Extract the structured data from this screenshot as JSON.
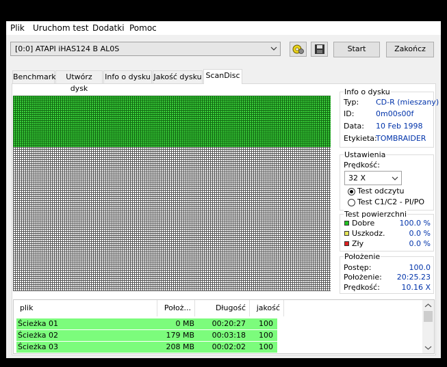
{
  "menu": [
    "Plik",
    "Uruchom test",
    "Dodatki",
    "Pomoc"
  ],
  "drive": {
    "selected": "[0:0]   ATAPI iHAS124   B AL0S"
  },
  "toolbar": {
    "start_label": "Start",
    "exit_label": "Zakończ"
  },
  "tabs": [
    "Benchmark",
    "Utwórz dysk",
    "Info o dysku",
    "Jakość dysku",
    "ScanDisc"
  ],
  "active_tab": "ScanDisc",
  "scan": {
    "done_fraction": 0.26
  },
  "disc_info": {
    "title": "Info o dysku",
    "type_label": "Typ:",
    "type_value": "CD-R (mieszany)",
    "id_label": "ID:",
    "id_value": "0m00s00f",
    "date_label": "Data:",
    "date_value": "10 Feb 1998",
    "label_label": "Etykieta:",
    "label_value": "TOMBRAIDER"
  },
  "settings": {
    "title": "Ustawienia",
    "speed_label": "Prędkość:",
    "speed_value": "32 X",
    "radio_read": "Test odczytu",
    "radio_c1c2": "Test C1/C2 - PI/PO",
    "selected_radio": "read"
  },
  "surface": {
    "title": "Test powierzchni",
    "good_label": "Dobre",
    "good_value": "100.0 %",
    "good_color": "#22c322",
    "damaged_label": "Uszkodz.",
    "damaged_value": "0.0 %",
    "damaged_color": "#e6e65a",
    "bad_label": "Zły",
    "bad_value": "0.0 %",
    "bad_color": "#e02020"
  },
  "position": {
    "title": "Położenie",
    "progress_label": "Postęp:",
    "progress_value": "100.0",
    "pos_label": "Położenie:",
    "pos_value": "20:25.23",
    "speed_label": "Prędkość:",
    "speed_value": "10.16 X"
  },
  "list": {
    "columns": [
      "plik",
      "Położ...",
      "Długość",
      "jakość"
    ],
    "rows": [
      {
        "name": "Ścieżka 01",
        "pos": "0 MB",
        "length": "00:20:27",
        "quality": "100"
      },
      {
        "name": "Ścieżka 02",
        "pos": "179 MB",
        "length": "00:03:18",
        "quality": "100"
      },
      {
        "name": "Ścieżka 03",
        "pos": "208 MB",
        "length": "00:02:02",
        "quality": "100"
      }
    ]
  }
}
